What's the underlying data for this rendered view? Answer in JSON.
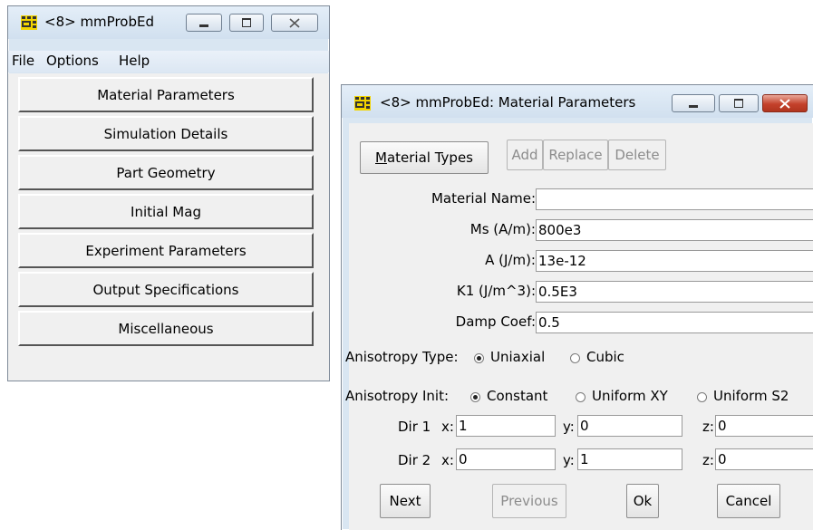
{
  "main_window": {
    "title": "<8> mmProbEd",
    "menu": [
      "File",
      "Options",
      "Help"
    ],
    "buttons": [
      "Material Parameters",
      "Simulation Details",
      "Part Geometry",
      "Initial Mag",
      "Experiment Parameters",
      "Output Specifications",
      "Miscellaneous"
    ]
  },
  "dialog": {
    "title": "<8> mmProbEd: Material Parameters",
    "material_types_label_u": "M",
    "material_types_label_rest": "aterial Types",
    "add_label": "Add",
    "replace_label": "Replace",
    "delete_label": "Delete",
    "fields": {
      "material_name_label": "Material Name:",
      "material_name_value": "",
      "ms_label": "Ms (A/m):",
      "ms_value": "800e3",
      "a_label": "A (J/m):",
      "a_value": "13e-12",
      "k1_label": "K1 (J/m^3):",
      "k1_value": "0.5E3",
      "damp_label": "Damp Coef:",
      "damp_value": "0.5"
    },
    "anisotropy_type": {
      "label": "Anisotropy Type:",
      "options": [
        "Uniaxial",
        "Cubic"
      ],
      "selected": "Uniaxial"
    },
    "anisotropy_init": {
      "label": "Anisotropy Init:",
      "options": [
        "Constant",
        "Uniform XY",
        "Uniform S2"
      ],
      "selected": "Constant"
    },
    "dir1": {
      "label": "Dir 1",
      "x_label": "x:",
      "x": "1",
      "y_label": "y:",
      "y": "0",
      "z_label": "z:",
      "z": "0"
    },
    "dir2": {
      "label": "Dir 2",
      "x_label": "x:",
      "x": "0",
      "y_label": "y:",
      "y": "1",
      "z_label": "z:",
      "z": "0"
    },
    "next_label": "Next",
    "previous_label": "Previous",
    "ok_label": "Ok",
    "cancel_label": "Cancel"
  },
  "colors": {
    "frame": "#d9e6f2",
    "client": "#f0f0f0",
    "close_red": "#c4412b"
  },
  "icons": [
    "mmprobed-app-icon",
    "minimize-icon",
    "maximize-icon",
    "close-icon"
  ]
}
